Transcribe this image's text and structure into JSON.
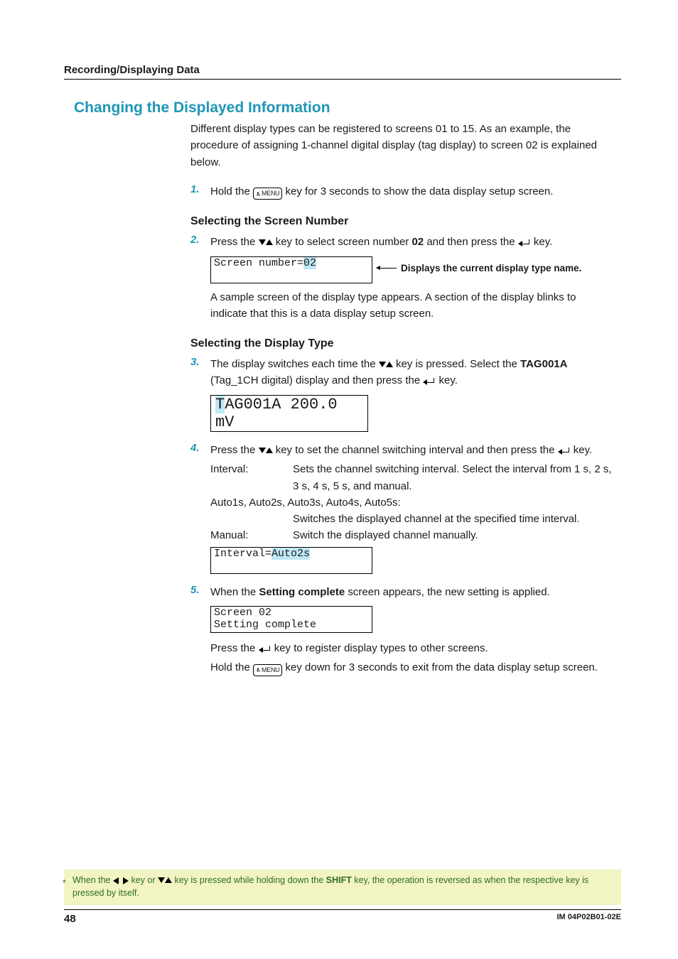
{
  "running_head": "Recording/Displaying Data",
  "section_title": "Changing the Displayed Information",
  "intro": "Different display types can be registered to screens 01 to 15. As an example, the procedure of assigning 1-channel digital display (tag display) to screen 02 is explained below.",
  "step1": {
    "num": "1",
    "before": "Hold the ",
    "menu": "MENU",
    "after": " key for 3 seconds to show the data display setup screen."
  },
  "sel_screen_heading": "Selecting the Screen Number",
  "step2": {
    "num": "2",
    "t1": "Press the ",
    "t2": " key to select screen number ",
    "bold": "02",
    "t3": " and then press the ",
    "t4": " key.",
    "lcd_prefix": "Screen number=",
    "lcd_value": "02",
    "callout": "Displays the current display type name.",
    "note": "A sample screen of the display type appears. A section of the display blinks to indicate that this is a data display setup screen."
  },
  "sel_type_heading": "Selecting the Display Type",
  "step3": {
    "num": "3",
    "t1": "The display switches each time the ",
    "t2": " key is pressed. Select the ",
    "bold": "TAG001A",
    "t3": " (Tag_1CH digital) display and then press the ",
    "t4": " key.",
    "lcd_hl": "T",
    "lcd_rest": "AG001A 200.0 mV"
  },
  "step4": {
    "num": "4",
    "t1": "Press the ",
    "t2": " key to set the channel switching interval and then press the ",
    "t3": " key.",
    "def_interval_term": "Interval:",
    "def_interval_desc": "Sets the channel switching interval. Select the interval from 1 s, 2 s, 3 s, 4 s, 5 s, and manual.",
    "auto_line": "Auto1s, Auto2s, Auto3s, Auto4s, Auto5s:",
    "auto_desc": "Switches the displayed channel at the specified time interval.",
    "def_manual_term": "Manual:",
    "def_manual_desc": "Switch the displayed channel manually.",
    "lcd_prefix": "Interval=",
    "lcd_value": "Auto2s"
  },
  "step5": {
    "num": "5",
    "t1": "When the ",
    "bold": "Setting complete",
    "t2": " screen appears, the new setting is applied.",
    "lcd_line1": "Screen 02",
    "lcd_line2": "Setting complete",
    "post1a": "Press the ",
    "post1b": " key to register display types to other screens.",
    "post2a": "Hold the ",
    "menu": "MENU",
    "post2b": " key down for 3 seconds to exit from the data display setup screen."
  },
  "footnote": {
    "star": "*",
    "t1": "When the ",
    "t2": " key or ",
    "t3": " key is pressed while holding down the ",
    "bold": "SHIFT",
    "t4": " key, the operation is reversed as when the respective key is pressed by itself."
  },
  "footer": {
    "page": "48",
    "docid": "IM 04P02B01-02E"
  }
}
